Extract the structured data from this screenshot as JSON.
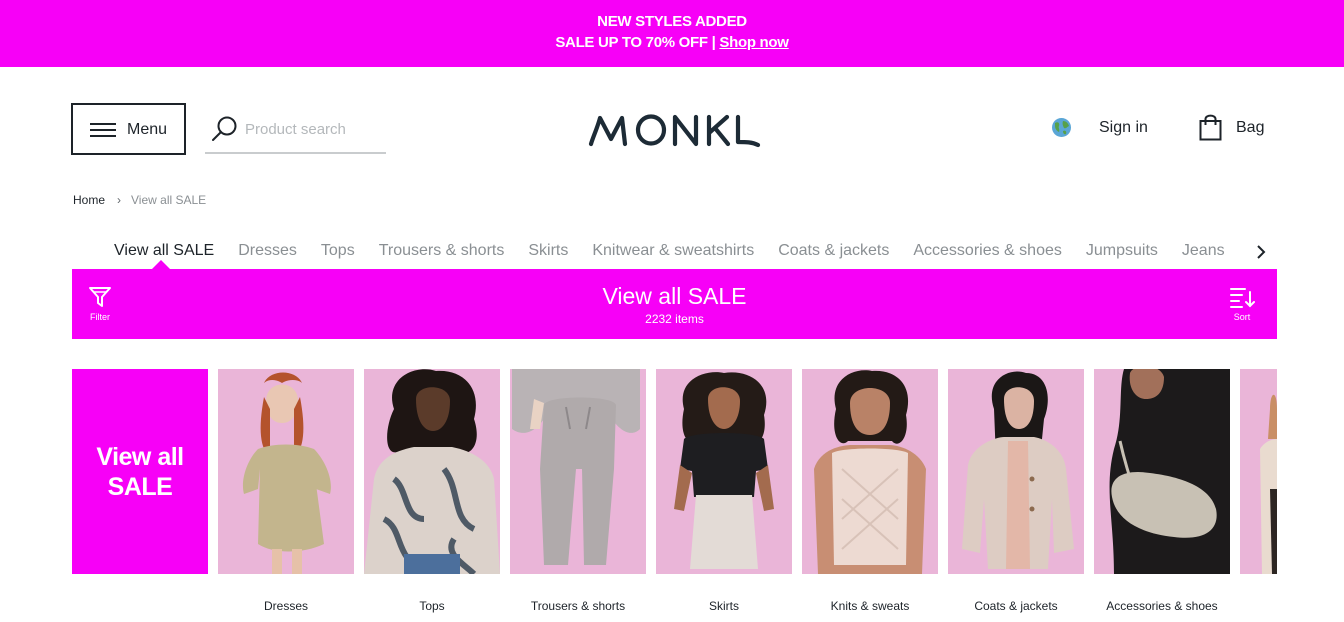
{
  "promo": {
    "line1": "NEW STYLES ADDED",
    "line2": "SALE UP TO 70% OFF | ",
    "link": "Shop now"
  },
  "header": {
    "menu_label": "Menu",
    "search_placeholder": "Product search",
    "logo": "MONKI",
    "signin_label": "Sign in",
    "bag_label": "Bag"
  },
  "breadcrumb": {
    "home": "Home",
    "separator": "›",
    "current": "View all SALE"
  },
  "tabs": [
    {
      "label": "View all SALE",
      "active": true
    },
    {
      "label": "Dresses"
    },
    {
      "label": "Tops"
    },
    {
      "label": "Trousers & shorts"
    },
    {
      "label": "Skirts"
    },
    {
      "label": "Knitwear & sweatshirts"
    },
    {
      "label": "Coats & jackets"
    },
    {
      "label": "Accessories & shoes"
    },
    {
      "label": "Jumpsuits"
    },
    {
      "label": "Jeans"
    }
  ],
  "salebar": {
    "title": "View all SALE",
    "count": "2232 items",
    "filter_label": "Filter",
    "sort_label": "Sort"
  },
  "categories": {
    "view_all": "View all SALE",
    "items": [
      {
        "label": "Dresses"
      },
      {
        "label": "Tops"
      },
      {
        "label": "Trousers & shorts"
      },
      {
        "label": "Skirts"
      },
      {
        "label": "Knits & sweats"
      },
      {
        "label": "Coats & jackets"
      },
      {
        "label": "Accessories & shoes"
      }
    ]
  },
  "colors": {
    "brand_magenta": "#f700f7",
    "tile_pink": "#eab5d8",
    "text_dark": "#1d2329",
    "text_muted": "#8a8f93"
  },
  "icons": [
    "hamburger-icon",
    "search-icon",
    "globe-icon",
    "bag-icon",
    "chevron-right-icon",
    "filter-icon",
    "sort-icon"
  ]
}
